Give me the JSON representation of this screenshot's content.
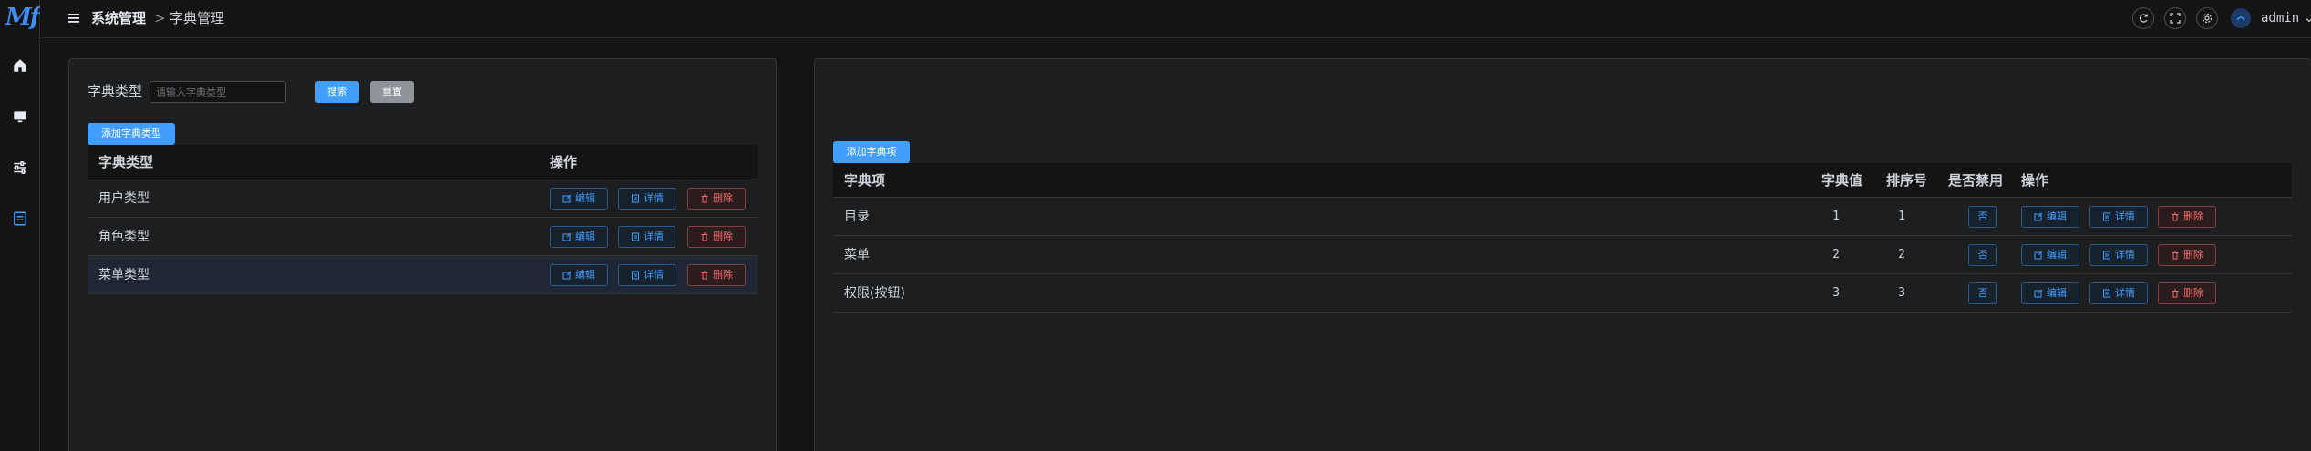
{
  "logo": "Mf",
  "header": {
    "breadcrumb": [
      "系统管理",
      "字典管理"
    ],
    "separator": ">",
    "user": "admin",
    "icons": [
      "refresh-icon",
      "fullscreen-icon",
      "settings-icon"
    ]
  },
  "sidebar": {
    "icons": [
      "home-icon",
      "monitor-icon",
      "sliders-icon",
      "dictionary-icon"
    ],
    "active": "dictionary-icon"
  },
  "left": {
    "search_label": "字典类型",
    "search_placeholder": "请输入字典类型",
    "search_value": "",
    "search_btn": "搜索",
    "reset_btn": "重置",
    "add_btn": "添加字典类型",
    "columns": [
      "字典类型",
      "操作"
    ],
    "rows": [
      {
        "name": "用户类型"
      },
      {
        "name": "角色类型"
      },
      {
        "name": "菜单类型"
      }
    ],
    "highlighted_row": 2
  },
  "right": {
    "add_btn": "添加字典项",
    "columns": [
      "字典项",
      "字典值",
      "排序号",
      "是否禁用",
      "操作"
    ],
    "rows": [
      {
        "item": "目录",
        "value": "1",
        "order": "1",
        "disabled": "否"
      },
      {
        "item": "菜单",
        "value": "2",
        "order": "2",
        "disabled": "否"
      },
      {
        "item": "权限(按钮)",
        "value": "3",
        "order": "3",
        "disabled": "否"
      }
    ]
  },
  "actions": {
    "edit": "编辑",
    "detail": "详情",
    "delete": "删除"
  },
  "colors": {
    "accent": "#409eff",
    "danger": "#f56c6c",
    "background": "#141414",
    "panel": "#1d1e1f"
  }
}
